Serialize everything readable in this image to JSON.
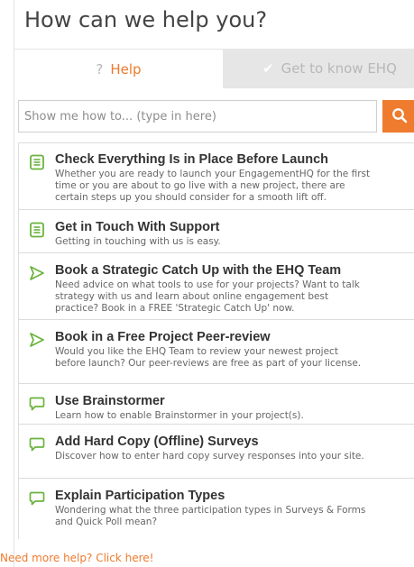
{
  "widget": {
    "title": "How can we help you?"
  },
  "tabs": [
    {
      "label": "Help",
      "icon": "question-icon",
      "active": true
    },
    {
      "label": "Get to know EHQ",
      "icon": "checkmark-icon",
      "active": false
    }
  ],
  "search": {
    "placeholder": "Show me how to... (type in here)",
    "value": "",
    "button_icon": "search-icon"
  },
  "articles": [
    {
      "title": "Check Everything Is in Place Before Launch",
      "description": "Whether you are ready to launch your EngagementHQ for the first time or you are about to go live with a new project, there are certain steps up you should consider for a smooth lift off.",
      "icon": "document-icon"
    },
    {
      "title": "Get in Touch With Support",
      "description": "Getting in touching with us is easy.",
      "icon": "document-icon"
    },
    {
      "title": "Book a Strategic Catch Up with the EHQ Team",
      "description": "Need advice on what tools to use for your projects? Want to talk strategy with us and learn about online engagement best practice? Book in a FREE 'Strategic Catch Up' now.",
      "icon": "send-icon"
    },
    {
      "title": "Book in a Free Project Peer-review",
      "description": "Would you like the EHQ Team to review your newest project before launch? Our peer-reviews are free as part of your license.",
      "icon": "send-icon"
    },
    {
      "title": "Use Brainstormer",
      "description": "Learn how to enable Brainstormer in your project(s).",
      "icon": "chat-bubble-icon"
    },
    {
      "title": "Add Hard Copy (Offline) Surveys",
      "description": "Discover how to enter hard copy survey responses into your site.",
      "icon": "chat-bubble-icon"
    },
    {
      "title": "Explain Participation Types",
      "description": "Wondering what the three participation types in Surveys & Forms and Quick Poll mean?",
      "icon": "chat-bubble-icon"
    }
  ],
  "footer": {
    "more_help_link": "Need more help? Click here!"
  },
  "colors": {
    "accent": "#ee7b2e",
    "icon_green": "#6bb33e",
    "tab_inactive_bg": "#e6e6e6",
    "title_text": "#444444"
  }
}
